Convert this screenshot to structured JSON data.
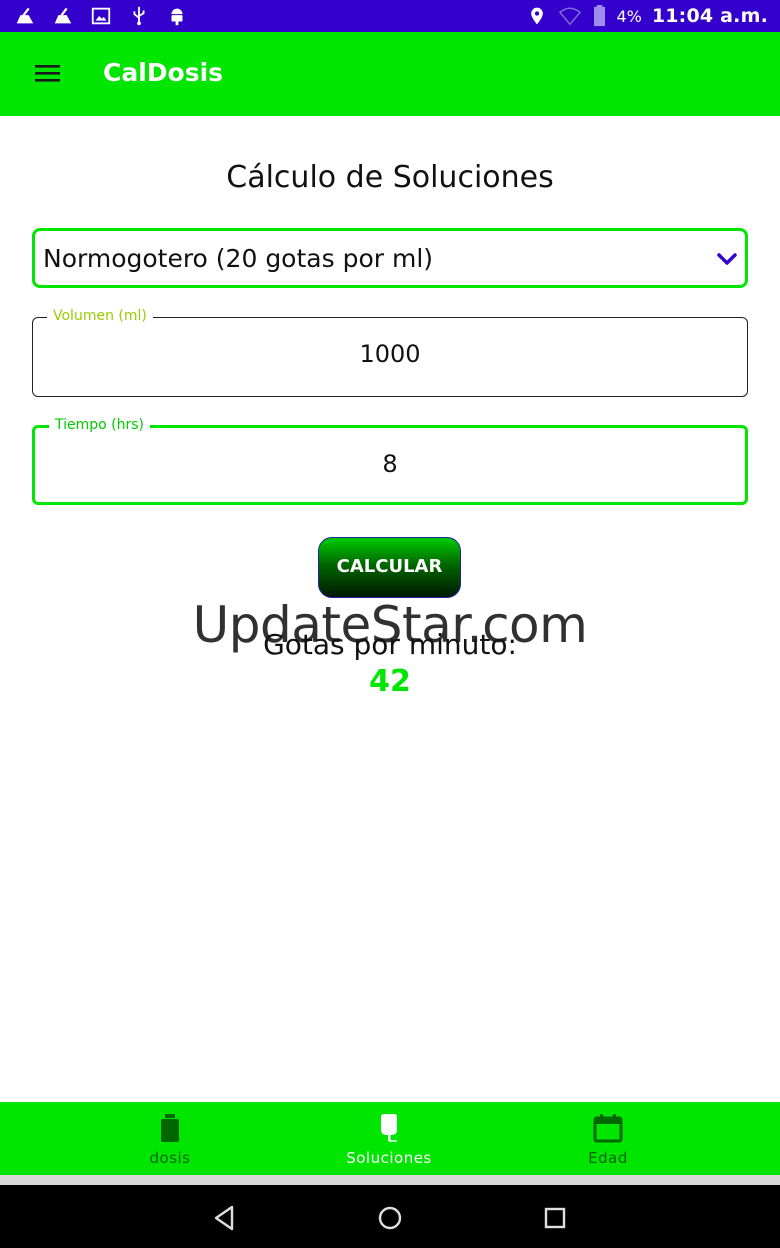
{
  "status_bar": {
    "icons_left": [
      "cleaner-icon",
      "cleaner-icon",
      "image-icon",
      "usb-icon",
      "android-debug-icon"
    ],
    "icons_right": [
      "location-icon",
      "wifi-icon",
      "battery-icon"
    ],
    "battery_percent": "4%",
    "time": "11:04 a.m."
  },
  "app_bar": {
    "title": "CalDosis",
    "menu_icon": "hamburger-menu-icon"
  },
  "main": {
    "title": "Cálculo de Soluciones",
    "dropdown": {
      "selected": "Normogotero (20 gotas por ml)"
    },
    "volume_field": {
      "label": "Volumen (ml)",
      "value": "1000"
    },
    "time_field": {
      "label": "Tiempo (hrs)",
      "value": "8"
    },
    "calculate_button": "CALCULAR",
    "result_label": "Gotas por minuto:",
    "result_value": "42"
  },
  "watermark": "UpdateStar.com",
  "bottom_nav": {
    "items": [
      {
        "label": "dosis",
        "icon": "bottle-icon"
      },
      {
        "label": "Soluciones",
        "icon": "iv-bag-icon",
        "active": true
      },
      {
        "label": "Edad",
        "icon": "calendar-icon"
      }
    ]
  },
  "colors": {
    "primary": "#00e600",
    "status_bar": "#3300cc",
    "accent": "#3300cc",
    "nav_inactive": "#006600"
  }
}
